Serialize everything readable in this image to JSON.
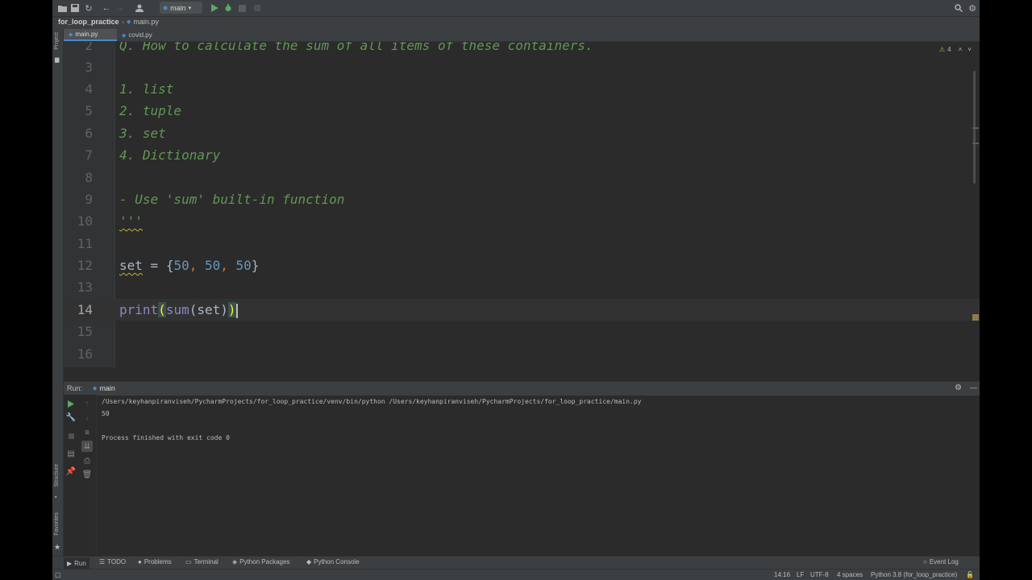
{
  "toolbar": {
    "run_config": "main"
  },
  "navbar": {
    "project": "for_loop_practice",
    "file": "main.py"
  },
  "left_stripe": {
    "project_label": "Project",
    "structure_label": "Structure",
    "favorites_label": "Favorites"
  },
  "tabs": [
    {
      "label": "main.py",
      "active": true
    },
    {
      "label": "covid.py",
      "active": false
    }
  ],
  "editor": {
    "warning_count": "4",
    "lines": [
      {
        "n": "2",
        "text": "Q. How to calculate the sum of all items of these containers."
      },
      {
        "n": "3",
        "text": ""
      },
      {
        "n": "4",
        "text": "1. list"
      },
      {
        "n": "5",
        "text": "2. tuple"
      },
      {
        "n": "6",
        "text": "3. set"
      },
      {
        "n": "7",
        "text": "4. Dictionary"
      },
      {
        "n": "8",
        "text": ""
      },
      {
        "n": "9",
        "text": "- Use 'sum' built-in function"
      },
      {
        "n": "10",
        "text": "'''"
      },
      {
        "n": "11",
        "text": ""
      },
      {
        "n": "12",
        "tokens": {
          "name": "set",
          "assign": " = ",
          "open": "{",
          "v1": "50",
          "c1": ", ",
          "v2": "50",
          "c2": ", ",
          "v3": "50",
          "close": "}"
        }
      },
      {
        "n": "13",
        "text": ""
      },
      {
        "n": "14",
        "tokens": {
          "fn": "print",
          "open": "(",
          "fn2": "sum",
          "open2": "(",
          "arg": "set",
          "close2": ")",
          "close": ")"
        }
      },
      {
        "n": "15",
        "text": ""
      },
      {
        "n": "16",
        "text": ""
      }
    ]
  },
  "run_panel": {
    "label": "Run:",
    "config": "main",
    "console": [
      "/Users/keyhanpiranviseh/PycharmProjects/for_loop_practice/venv/bin/python /Users/keyhanpiranviseh/PycharmProjects/for_loop_practice/main.py",
      "50",
      "",
      "Process finished with exit code 0"
    ]
  },
  "bottom_bar": {
    "run": "Run",
    "todo": "TODO",
    "problems": "Problems",
    "terminal": "Terminal",
    "python_packages": "Python Packages",
    "python_console": "Python Console",
    "event_log": "Event Log"
  },
  "status_bar": {
    "position": "14:16",
    "line_sep": "LF",
    "encoding": "UTF-8",
    "indent": "4 spaces",
    "interpreter": "Python 3.8 (for_loop_practice)"
  },
  "colors": {
    "docstring": "#629755",
    "number": "#6897bb",
    "builtin": "#8888c6",
    "run_green": "#59a869",
    "accent_blue": "#4a88c7"
  }
}
